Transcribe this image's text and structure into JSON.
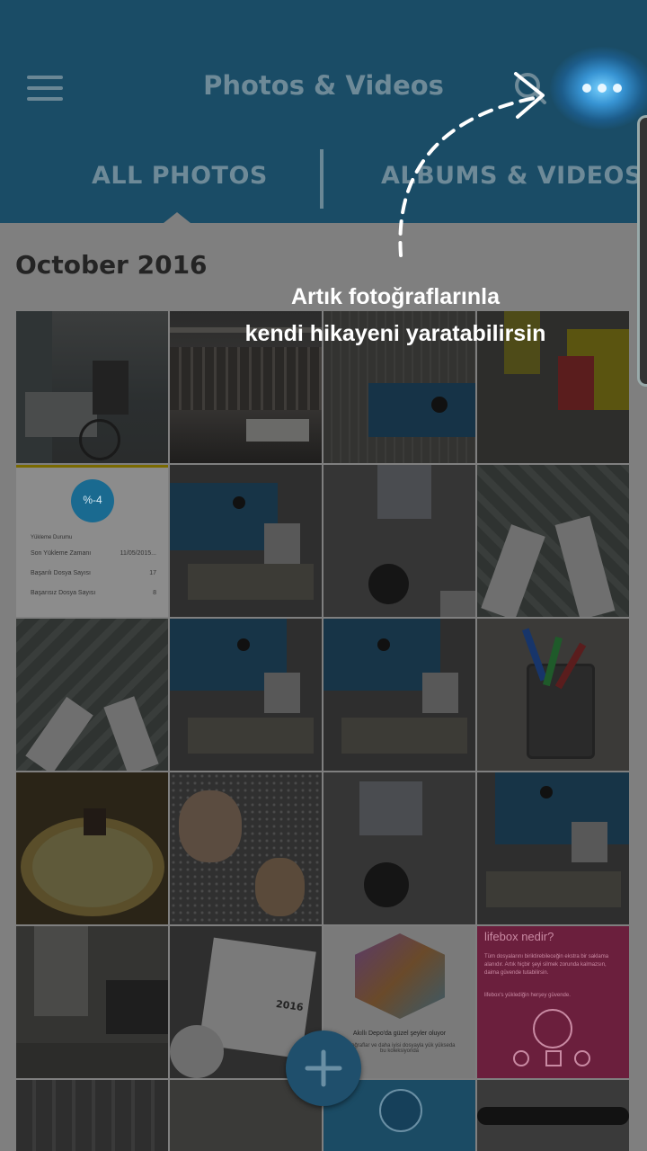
{
  "header": {
    "title": "Photos & Videos",
    "menu_icon": "hamburger-icon",
    "search_icon": "search-icon",
    "more_icon": "more-horizontal-icon"
  },
  "tabs": [
    {
      "label": "ALL PHOTOS",
      "active": true
    },
    {
      "label": "ALBUMS & VIDEOS",
      "active": false
    }
  ],
  "section": {
    "month": "October 2016"
  },
  "tooltip": {
    "line1": "Artık fotoğraflarınla",
    "line2": "kendi hikayeni yaratabilirsin"
  },
  "thumbnails": {
    "upload_stats": {
      "percent": "%-4",
      "heading": "Yükleme Durumu",
      "rows": [
        {
          "label": "Son Yükleme Zamanı",
          "value": "11/05/2015..."
        },
        {
          "label": "Başarılı Dosya Sayısı",
          "value": "17"
        },
        {
          "label": "Başarısız Dosya Sayısı",
          "value": "8"
        }
      ]
    },
    "calendar_year": "2016",
    "depo_caption": "Akıllı Depo'da güzel şeyler oluyor",
    "depo_sub": "Fotoğraflar ve daha iyisi dosyayla yük yükseda bu koleksiyonda",
    "lifebox": {
      "title": "lifebox nedir?",
      "body": "Tüm dosyalarını biriktirebileceğin ekstra bir saklama alanıdır. Artık hiçbir şeyi silmek zorunda kalmazsın, daima güvende tutabilirsin.",
      "footer": "lifebox's yüklediğin herşey güvende."
    }
  },
  "fab": {
    "icon": "plus-icon"
  },
  "colors": {
    "header_bg": "#1a4c66",
    "content_bg": "#7f7f7f",
    "accent": "#3ab4f2",
    "lifebox_pink": "#d4326e"
  }
}
